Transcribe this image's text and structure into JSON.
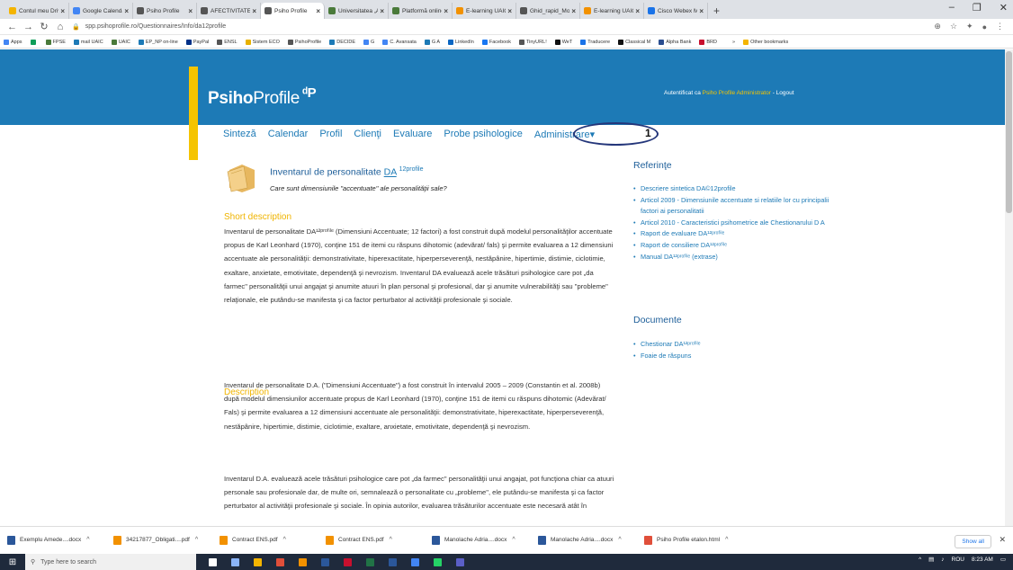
{
  "browser": {
    "tabs": [
      {
        "label": "Contul meu Drive",
        "color": "#f4b400"
      },
      {
        "label": "Google Calendar",
        "color": "#4285f4"
      },
      {
        "label": "Psiho Profile",
        "color": "#555555"
      },
      {
        "label": "AFECTIVITATE / P",
        "color": "#555555"
      },
      {
        "label": "Psiho Profile",
        "color": "#555555",
        "active": true
      },
      {
        "label": "Universitatea „A",
        "color": "#4a7a3a"
      },
      {
        "label": "Platformă online",
        "color": "#4a7a3a"
      },
      {
        "label": "E-learning UAIC",
        "color": "#f29100"
      },
      {
        "label": "Ghid_rapid_Mod",
        "color": "#555555"
      },
      {
        "label": "E-learning UAIC",
        "color": "#f29100"
      },
      {
        "label": "Cisco Webex Me",
        "color": "#1a73e8"
      }
    ],
    "new_tab": "+",
    "window_controls": [
      "–",
      "❐",
      "✕"
    ],
    "url": "spp.psihoprofile.ro/Questionnaires/Info/da12profile",
    "bookmarks": [
      {
        "label": "Apps",
        "color": "#4285f4"
      },
      {
        "label": "",
        "color": "#0f9d58"
      },
      {
        "label": "FPSE",
        "color": "#4a7a3a"
      },
      {
        "label": "mail UAIC",
        "color": "#1d7ab6"
      },
      {
        "label": "UAIC",
        "color": "#4a7a3a"
      },
      {
        "label": "EP_NP on-line",
        "color": "#1d7ab6"
      },
      {
        "label": "PayPal",
        "color": "#003087"
      },
      {
        "label": "ENSL",
        "color": "#555555"
      },
      {
        "label": "Sistem ECO",
        "color": "#e8b100"
      },
      {
        "label": "PsihoProfile",
        "color": "#555555"
      },
      {
        "label": "DECIDE",
        "color": "#1d7ab6"
      },
      {
        "label": "G",
        "color": "#4285f4"
      },
      {
        "label": "C. Avansata",
        "color": "#4285f4"
      },
      {
        "label": "G A",
        "color": "#1d7ab6"
      },
      {
        "label": "LinkedIn",
        "color": "#0a66c2"
      },
      {
        "label": "Facebook",
        "color": "#1877f2"
      },
      {
        "label": "TinyURL!",
        "color": "#555555"
      },
      {
        "label": "WeT",
        "color": "#111111"
      },
      {
        "label": "Traducere",
        "color": "#1a73e8"
      },
      {
        "label": "Classical M",
        "color": "#111111"
      },
      {
        "label": "Alpha Bank",
        "color": "#2a4d8f"
      },
      {
        "label": "BRD",
        "color": "#c8102e"
      },
      {
        "label": "»",
        "color": "#ffffff"
      },
      {
        "label": "Other bookmarks",
        "color": "#f4b400"
      }
    ]
  },
  "site": {
    "brand_bold": "Psiho",
    "brand_rest": "Profile",
    "brand_symbol": "ᵈP",
    "auth_prefix": "Autentificat ca",
    "auth_user": "Psiho Profile Administrator",
    "auth_sep": "-",
    "logout": "Logout",
    "nav": [
      "Sinteză",
      "Calendar",
      "Profil",
      "Clienţi",
      "Evaluare",
      "Probe psihologice",
      "Administrare"
    ],
    "annotation_number": "1",
    "colors": {
      "brand_blue": "#1d7ab6",
      "accent_yellow": "#f5c400",
      "heading_orange": "#f0b400"
    }
  },
  "content": {
    "title_prefix": "Inventarul de personalitate",
    "title_link": "DA",
    "title_sup": "12profile",
    "subtitle": "Care sunt dimensiunile \"accentuate\" ale personalităţii sale?",
    "short_heading": "Short description",
    "short_text": "Inventarul de personalitate DA¹²ᵖʳᵒᶠⁱˡᵉ (Dimensiuni Accentuate; 12 factori) a fost construit după modelul personalităţilor accentuate propus de Karl Leonhard (1970), conţine 151 de itemi cu răspuns dihotomic (adevărat/ fals) şi permite evaluarea a 12 dimensiuni accentuate ale personalităţii: demonstrativitate, hiperexactitate, hiperperseverenţă, nestăpânire, hipertimie, distimie, ciclotimie, exaltare, anxietate, emotivitate, dependenţă şi nevrozism. Inventarul DA evaluează acele trăsături psihologice care pot „da farmec\" personalităţii unui angajat şi anumite atuuri în plan personal şi profesional, dar şi anumite vulnerabilităţi sau \"probleme\" relaţionale, ele putându-se manifesta şi ca factor perturbator al activităţii profesionale şi sociale.",
    "desc_heading": "Description",
    "desc_text_1": "Inventarul de personalitate D.A. (\"Dimensiuni Accentuate\") a fost construit în intervalul 2005 – 2009 (Constantin et al. 2008b) după modelul dimensiunilor accentuate propus de Karl Leonhard (1970), conţine 151 de itemi cu răspuns dihotomic (Adevărat/ Fals) şi permite evaluarea a 12 dimensiuni accentuate ale personalităţii: demonstrativitate, hiperexactitate, hiperperseverenţă, nestăpânire, hipertimie, distimie, ciclotimie, exaltare, anxietate, emotivitate, dependenţă şi nevrozism.",
    "desc_text_2": "Inventarul D.A. evaluează acele trăsături psihologice care pot „da farmec\" personalităţii unui angajat, pot funcţiona chiar ca atuuri personale sau profesionale dar, de multe ori, semnalează o personalitate cu „probleme\", ele putându-se manifesta şi ca factor perturbator al activităţii profesionale şi sociale. În opinia autorilor, evaluarea trăsăturilor accentuate este necesară atât în"
  },
  "sidebar": {
    "ref_heading": "Referinţe",
    "references": [
      "Descriere sintetica DA©12profile",
      "Articol 2009 - Dimensiunile accentuate si relatiile lor cu principalii factori ai personalitatii",
      "Articol 2010 - Caracteristici psihometrice ale Chestionarului D A",
      "Raport de evaluare DA¹²ᵖʳᵒᶠⁱˡᵉ",
      "Raport de consiliere DA¹²ᵖʳᵒᶠⁱˡᵉ",
      "Manual DA¹²ᵖʳᵒᶠⁱˡᵉ (extrase)"
    ],
    "doc_heading": "Documente",
    "documents": [
      "Chestionar DA¹²ᵖʳᵒᶠⁱˡᵉ",
      "Foaie de răspuns"
    ]
  },
  "downloads": {
    "items": [
      {
        "label": "Exemplu Amede....docx",
        "color": "#2b579a"
      },
      {
        "label": "34217877_Obligati....pdf",
        "color": "#f29100"
      },
      {
        "label": "Contract ENS.pdf",
        "color": "#f29100"
      },
      {
        "label": "Contract ENS.pdf",
        "color": "#f29100"
      },
      {
        "label": "Manolache Adria....docx",
        "color": "#2b579a"
      },
      {
        "label": "Manolache Adria....docx",
        "color": "#2b579a"
      },
      {
        "label": "Psiho Profile etalon.html",
        "color": "#e04f3a"
      }
    ],
    "show_all": "Show all",
    "close": "✕"
  },
  "taskbar": {
    "search_placeholder": "Type here to search",
    "tray_lang": "ROU",
    "tray_time": "8:23 AM"
  }
}
